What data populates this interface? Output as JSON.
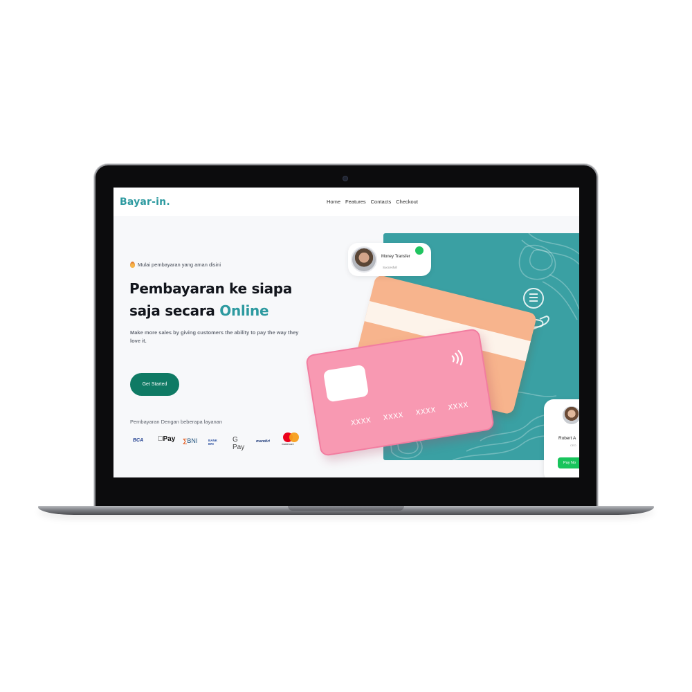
{
  "site": {
    "logo": "Bayar-in.",
    "nav": [
      "Home",
      "Features",
      "Contacts",
      "Checkout"
    ]
  },
  "hero": {
    "tag": "Mulai pembayaran yang aman disini",
    "headline_line1": "Pembayaran ke siapa",
    "headline_line2_prefix": "saja secara ",
    "headline_accent": "Online",
    "subtitle": "Make more sales by giving customers the ability to pay the way they love it.",
    "cta_label": "Get Started"
  },
  "payments": {
    "label": "Pembayaran Dengan beberapa layanan",
    "logos": {
      "bca": "BCA",
      "applepay": "Pay",
      "bni": "BNI",
      "bankbri": "BANK BRI",
      "gpay": "G Pay",
      "mandiri": "mandiri",
      "mastercard": "mastercard"
    }
  },
  "cards": {
    "front_numbers": [
      "XXXX",
      "XXXX",
      "XXXX",
      "XXXX"
    ]
  },
  "money_transfer": {
    "title": "Money Transfer",
    "status": "Succesfull"
  },
  "receiver_card": {
    "name": "Robert A",
    "role": "CEO",
    "button": "Pay No"
  },
  "colors": {
    "brand": "#2d9aa0",
    "cta": "#0f7a64",
    "card_pink": "#f899b2",
    "card_peach": "#f7b48d",
    "success": "#1fc460"
  }
}
